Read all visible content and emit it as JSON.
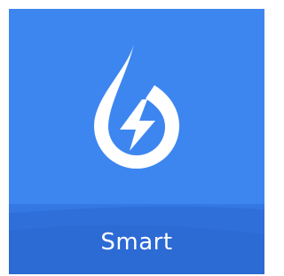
{
  "app": {
    "label": "Smart",
    "icon": "water-drop-lightning-icon",
    "colors": {
      "tile_background": "#3d86f0",
      "band_background": "#2f6fd9",
      "foreground": "#ffffff"
    }
  }
}
